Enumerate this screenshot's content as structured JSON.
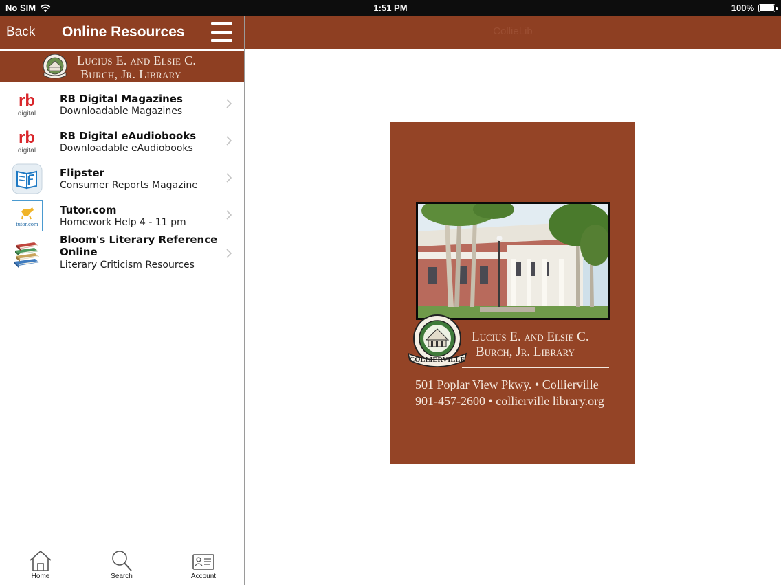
{
  "status_bar": {
    "carrier": "No SIM",
    "time": "1:51 PM",
    "battery": "100%"
  },
  "nav": {
    "back_label": "Back",
    "title": "Online Resources"
  },
  "banner": {
    "line1": "Lucius E. and Elsie C.",
    "line2": "Burch, Jr. Library"
  },
  "resources": [
    {
      "title": "RB Digital Magazines",
      "subtitle": "Downloadable Magazines",
      "icon": "rbdigital-icon"
    },
    {
      "title": "RB Digital eAudiobooks",
      "subtitle": "Downloadable eAudiobooks",
      "icon": "rbdigital-icon"
    },
    {
      "title": "Flipster",
      "subtitle": "Consumer Reports Magazine",
      "icon": "flipster-icon"
    },
    {
      "title": "Tutor.com",
      "subtitle": "Homework Help 4 - 11 pm",
      "icon": "tutor-icon"
    },
    {
      "title_line1": "Bloom's Literary Reference",
      "title_line2": "Online",
      "subtitle": "Literary Criticism Resources",
      "icon": "books-icon"
    }
  ],
  "icon_labels": {
    "rb": "rb",
    "digital": "digital",
    "tutor": "tutor.com",
    "collierville_seal": "COLLIERVILLE"
  },
  "tabs": [
    {
      "label": "Home",
      "icon": "home-icon"
    },
    {
      "label": "Search",
      "icon": "search-icon"
    },
    {
      "label": "Account",
      "icon": "account-card-icon"
    }
  ],
  "detail": {
    "title": "CollieLib",
    "card": {
      "name_line1": "Lucius E. and Elsie C.",
      "name_line2": "Burch, Jr. Library",
      "address": "501 Poplar View Pkwy. • Collierville",
      "contact": "901-457-2600  •  collierville library.org"
    }
  },
  "colors": {
    "brand": "#8e3f22",
    "card": "#944426",
    "cream": "#f4e8de",
    "rb_red": "#d9262b"
  }
}
